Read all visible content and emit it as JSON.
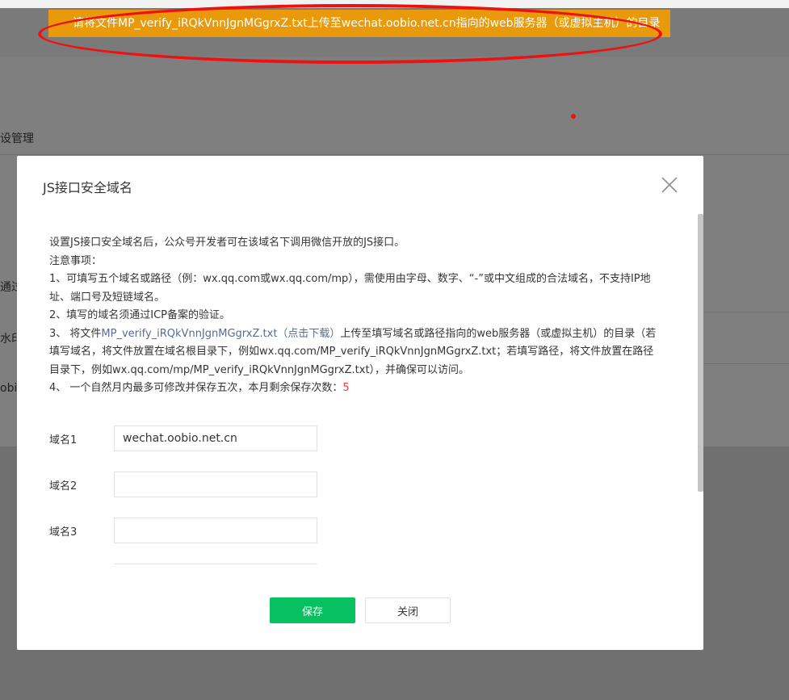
{
  "background": {
    "menu_partial_1": "设管理",
    "side_partial_1": "通过",
    "side_partial_2": "水印",
    "side_partial_3": "obio"
  },
  "notice": {
    "text": "请将文件MP_verify_iRQkVnnJgnMGgrxZ.txt上传至wechat.oobio.net.cn指向的web服务器（或虚拟主机）的目录",
    "color": "#e89a0c"
  },
  "dialog": {
    "title": "JS接口安全域名",
    "close_icon": "close-icon",
    "intro": "设置JS接口安全域名后，公众号开发者可在该域名下调用微信开放的JS接口。",
    "notes_heading": "注意事项：",
    "note1": "1、可填写五个域名或路径（例：wx.qq.com或wx.qq.com/mp），需使用由字母、数字、“-”或中文组成的合法域名，不支持IP地址、端口号及短链域名。",
    "note2": "2、填写的域名须通过ICP备案的验证。",
    "note3_prefix": "3、 将文件",
    "note3_link": "MP_verify_iRQkVnnJgnMGgrxZ.txt（点击下载）",
    "note3_suffix": "上传至填写域名或路径指向的web服务器（或虚拟主机）的目录（若填写域名，将文件放置在域名根目录下，例如wx.qq.com/MP_verify_iRQkVnnJgnMGgrxZ.txt；若填写路径，将文件放置在路径目录下，例如wx.qq.com/mp/MP_verify_iRQkVnnJgnMGgrxZ.txt），并确保可以访问。",
    "note4_prefix": "4、 一个自然月内最多可修改并保存五次，本月剩余保存次数：",
    "note4_count": "5",
    "fields": [
      {
        "label": "域名1",
        "value": "wechat.oobio.net.cn"
      },
      {
        "label": "域名2",
        "value": ""
      },
      {
        "label": "域名3",
        "value": ""
      }
    ],
    "save_label": "保存",
    "close_label": "关闭"
  },
  "colors": {
    "primary_green": "#07c160",
    "link_blue": "#576b95",
    "count_red": "#e64340",
    "annotation_red": "#ee1111"
  }
}
